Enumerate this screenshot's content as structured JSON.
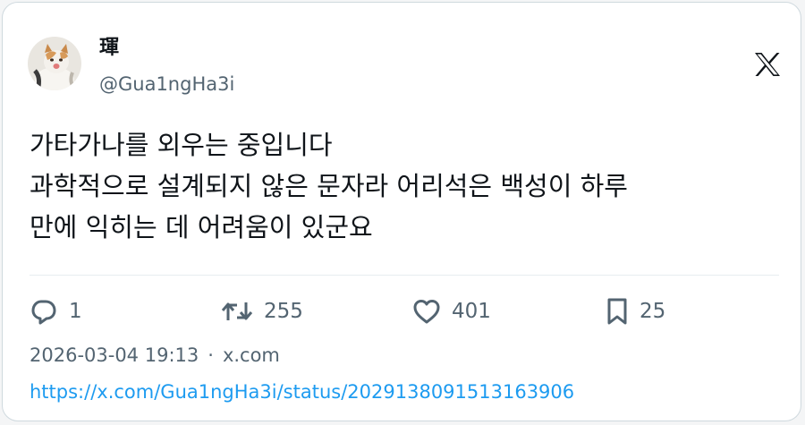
{
  "author": {
    "display_name": "琿",
    "handle": "@Gua1ngHa3i",
    "avatar_icon": "cat-photo-avatar"
  },
  "brand": {
    "logo_icon": "x-logo-icon"
  },
  "tweet": {
    "lines": [
      "가타가나를 외우는 중입니다",
      "과학적으로 설계되지 않은 문자라 어리석은 백성이 하루",
      "만에 익히는 데 어려움이 있군요"
    ]
  },
  "actions": {
    "reply": {
      "icon": "reply-icon",
      "count": "1"
    },
    "retweet": {
      "icon": "retweet-icon",
      "count": "255"
    },
    "like": {
      "icon": "heart-icon",
      "count": "401"
    },
    "bookmark": {
      "icon": "bookmark-icon",
      "count": "25"
    }
  },
  "meta": {
    "timestamp": "2026-03-04 19:13",
    "separator": "·",
    "domain": "x.com"
  },
  "link": {
    "url": "https://x.com/Gua1ngHa3i/status/2029138091513163906"
  },
  "colors": {
    "text": "#0f1419",
    "secondary": "#536471",
    "link": "#1d9bf0",
    "border": "#cfd9de",
    "background": "#f4f5f6"
  }
}
